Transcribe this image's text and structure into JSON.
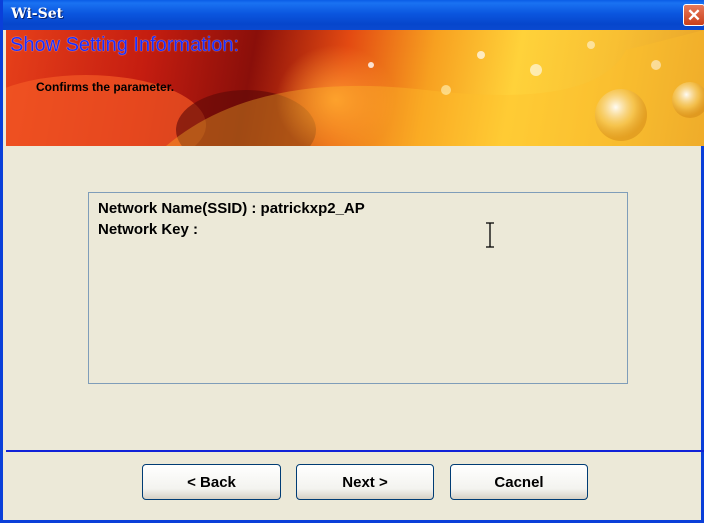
{
  "window": {
    "title": "Wi-Set"
  },
  "banner": {
    "title": "Show Setting Information:",
    "subtitle": "Confirms the parameter."
  },
  "info": {
    "network_name": "Network Name(SSID) : patrickxp2_AP",
    "network_key": "Network Key :"
  },
  "buttons": {
    "back": "< Back",
    "next": "Next >",
    "cancel": "Cacnel"
  },
  "icons": {
    "close": "close-icon",
    "text_cursor": "i-beam-cursor-icon"
  },
  "colors": {
    "titlebar": "#0a49d0",
    "divider": "#1022d8",
    "banner_title": "#1a2eff",
    "box_border": "#7f9db9"
  }
}
